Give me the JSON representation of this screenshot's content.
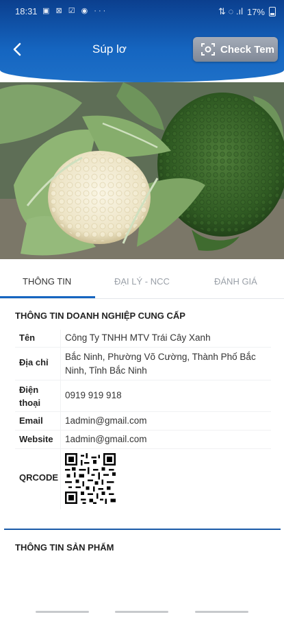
{
  "status_bar": {
    "time": "18:31",
    "left_icons": "▣ ⊠ ☑ ◉ ···",
    "right_icons": "⇅ ◌ .ıl",
    "battery": "17%"
  },
  "header": {
    "title": "Súp lơ",
    "check_button_label": "Check Tem"
  },
  "tabs": [
    {
      "label": "THÔNG TIN",
      "active": true
    },
    {
      "label": "ĐẠI LÝ - NCC",
      "active": false
    },
    {
      "label": "ĐÁNH GIÁ",
      "active": false
    }
  ],
  "supplier_section": {
    "title": "THÔNG TIN DOANH NGHIỆP CUNG CẤP",
    "rows": [
      {
        "label": "Tên",
        "value": "Công Ty TNHH MTV Trái Cây Xanh"
      },
      {
        "label": "Địa chỉ",
        "value": "Bắc Ninh, Phường Võ Cường, Thành Phố Bắc Ninh, Tỉnh Bắc Ninh"
      },
      {
        "label": "Điện thoại",
        "value": "0919 919 918"
      },
      {
        "label": "Email",
        "value": "1admin@gmail.com"
      },
      {
        "label": "Website",
        "value": "1admin@gmail.com"
      },
      {
        "label": "QRCODE",
        "value": ""
      }
    ]
  },
  "product_section": {
    "title": "THÔNG TIN SẢN PHẨM"
  },
  "colors": {
    "header_blue": "#1565c0",
    "tab_accent": "#1565c0",
    "check_button_gray": "#8a93a0"
  }
}
